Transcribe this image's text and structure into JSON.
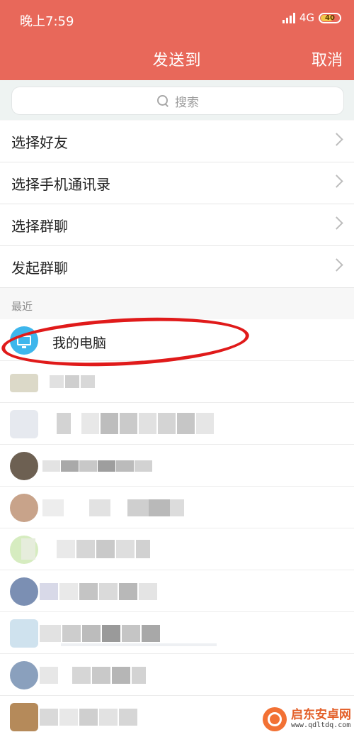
{
  "status_bar": {
    "time": "晚上7:59",
    "network": "4G",
    "battery": "40"
  },
  "nav": {
    "title": "发送到",
    "cancel": "取消"
  },
  "search": {
    "placeholder": "搜索"
  },
  "menu": [
    {
      "label": "选择好友"
    },
    {
      "label": "选择手机通讯录"
    },
    {
      "label": "选择群聊"
    },
    {
      "label": "发起群聊"
    }
  ],
  "recent": {
    "label": "最近",
    "items": [
      {
        "name": "我的电脑"
      }
    ]
  },
  "watermark": {
    "name": "启东安卓网",
    "url": "www.qdltdq.com"
  },
  "colors": {
    "header": "#e8685a",
    "pc_avatar": "#3eb6ec",
    "annotation": "#e01a1a"
  }
}
